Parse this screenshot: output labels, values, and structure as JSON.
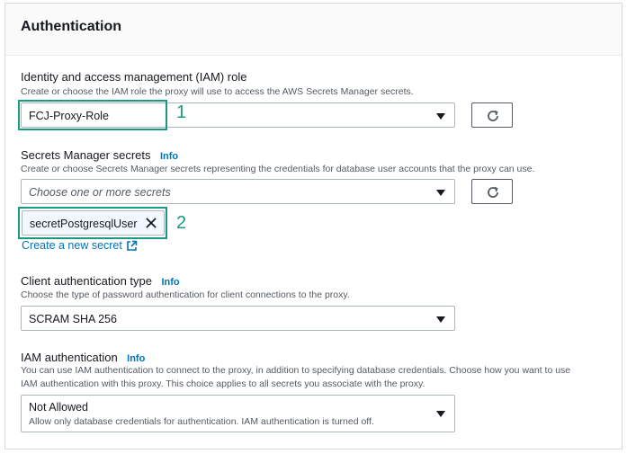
{
  "panel": {
    "title": "Authentication"
  },
  "iam_role": {
    "label": "Identity and access management (IAM) role",
    "description": "Create or choose the IAM role the proxy will use to access the AWS Secrets Manager secrets.",
    "value": "FCJ-Proxy-Role",
    "annotation": "1"
  },
  "secrets": {
    "label": "Secrets Manager secrets",
    "info": "Info",
    "description": "Create or choose Secrets Manager secrets representing the credentials for database user accounts that the proxy can use.",
    "placeholder": "Choose one or more secrets",
    "selected_token": "secretPostgresqlUser",
    "annotation": "2",
    "create_link": "Create a new secret"
  },
  "client_auth": {
    "label": "Client authentication type",
    "info": "Info",
    "description": "Choose the type of password authentication for client connections to the proxy.",
    "value": "SCRAM SHA 256"
  },
  "iam_auth": {
    "label": "IAM authentication",
    "info": "Info",
    "description_line1": "You can use IAM authentication to connect to the proxy, in addition to specifying database credentials. Choose how you want to use",
    "description_line2": "IAM authentication with this proxy. This choice applies to all secrets you associate with the proxy.",
    "value": "Not Allowed",
    "value_description": "Allow only database credentials for authentication. IAM authentication is turned off."
  },
  "colors": {
    "highlight": "#1a9a80",
    "link": "#0073bb"
  },
  "icons": [
    "refresh-icon",
    "close-icon",
    "external-link-icon",
    "caret-down-icon"
  ]
}
